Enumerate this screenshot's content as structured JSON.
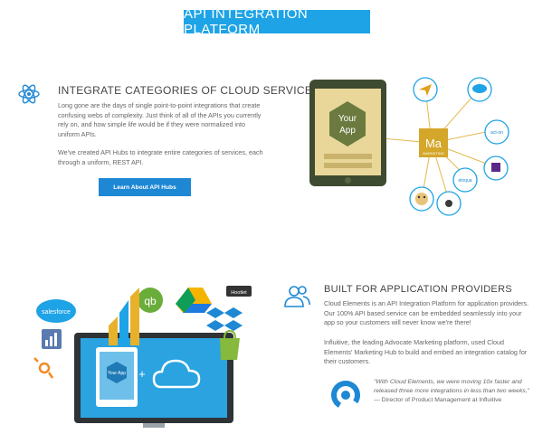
{
  "banner": {
    "title": "API INTEGRATION PLATFORM"
  },
  "section1": {
    "title": "INTEGRATE CATEGORIES OF CLOUD SERVICES",
    "para1": "Long gone are the days of single point-to-point integrations that create confusing webs of complexity. Just think of all of the APIs you currently rely on, and how simple life would be if they were normalized into uniform APIs.",
    "para2": "We've created API Hubs to integrate entire categories of services, each through a uniform, REST API.",
    "button": "Learn About API Hubs"
  },
  "diagram": {
    "app_label_1": "Your",
    "app_label_2": "App",
    "hub_label": "Ma",
    "hub_sublabel": "MARKETING",
    "nodes": [
      "salesforce",
      "act-on",
      "marketo",
      "eloqua",
      "hubspot",
      "mailchimp"
    ]
  },
  "section2": {
    "title": "BUILT FOR APPLICATION PROVIDERS",
    "para1": "Cloud Elements is an API Integration Platform for application providers. Our 100% API based service can be embedded seamlessly into your app so your customers will never know we're there!",
    "para2": "Influitive, the leading Advocate Marketing platform, used Cloud Elements' Marketing Hub to build and embed an integration catalog for their customers.",
    "quote": "\"With Cloud Elements, we were moving 10x faster and released three more integrations in less than two weeks,\"",
    "attribution": "— Director of Product Management at Influitive"
  },
  "collage": {
    "salesforce": "salesforce",
    "hootsuite": "Hootlet",
    "app_label": "Your App",
    "plus": "+"
  },
  "colors": {
    "accent": "#1ea3e6",
    "button": "#1e88d4",
    "hub": "#d4a62a",
    "tablet": "#3f4b30"
  }
}
